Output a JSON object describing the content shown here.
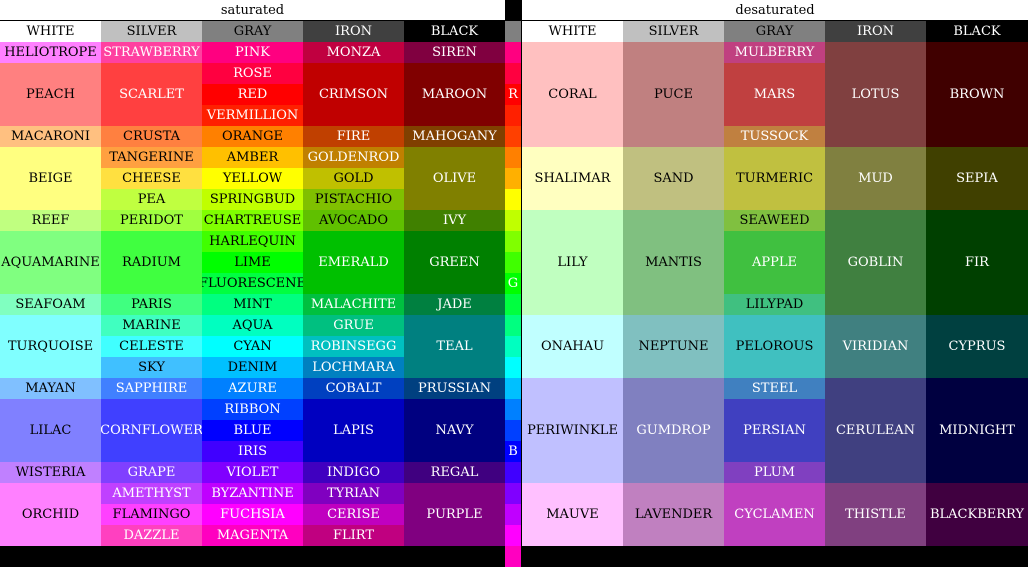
{
  "title_saturated": "saturated",
  "title_desaturated": "desaturated",
  "headers": {
    "saturated": [
      {
        "label": "WHITE",
        "bg": "#ffffff",
        "fg": "#000000"
      },
      {
        "label": "SILVER",
        "bg": "#c0c0c0",
        "fg": "#000000"
      },
      {
        "label": "GRAY",
        "bg": "#808080",
        "fg": "#000000"
      },
      {
        "label": "IRON",
        "bg": "#404040",
        "fg": "#ffffff"
      },
      {
        "label": "BLACK",
        "bg": "#000000",
        "fg": "#ffffff"
      }
    ],
    "desaturated": [
      {
        "label": "WHITE",
        "bg": "#ffffff",
        "fg": "#000000"
      },
      {
        "label": "SILVER",
        "bg": "#c0c0c0",
        "fg": "#000000"
      },
      {
        "label": "GRAY",
        "bg": "#808080",
        "fg": "#000000"
      },
      {
        "label": "IRON",
        "bg": "#404040",
        "fg": "#ffffff"
      },
      {
        "label": "BLACK",
        "bg": "#000000",
        "fg": "#ffffff"
      }
    ]
  },
  "strip": [
    {
      "label": "",
      "bg": "#ff0080"
    },
    {
      "label": "",
      "bg": "#ff0080"
    },
    {
      "label": "",
      "bg": "#ff0040"
    },
    {
      "label": "R",
      "bg": "#ff0000"
    },
    {
      "label": "",
      "bg": "#ff2000"
    },
    {
      "label": "",
      "bg": "#ff4000"
    },
    {
      "label": "",
      "bg": "#ff8000"
    },
    {
      "label": "",
      "bg": "#ffb000"
    },
    {
      "label": "",
      "bg": "#ffff00"
    },
    {
      "label": "",
      "bg": "#c0ff00"
    },
    {
      "label": "",
      "bg": "#80ff00"
    },
    {
      "label": "",
      "bg": "#40ff00"
    },
    {
      "label": "G",
      "bg": "#00ff00"
    },
    {
      "label": "",
      "bg": "#00ff40"
    },
    {
      "label": "",
      "bg": "#00ff80"
    },
    {
      "label": "",
      "bg": "#00ffc0"
    },
    {
      "label": "",
      "bg": "#00ffff"
    },
    {
      "label": "",
      "bg": "#00c0ff"
    },
    {
      "label": "",
      "bg": "#0080ff"
    },
    {
      "label": "",
      "bg": "#0040ff"
    },
    {
      "label": "B",
      "bg": "#0000ff"
    },
    {
      "label": "",
      "bg": "#4000ff"
    },
    {
      "label": "",
      "bg": "#8000ff"
    },
    {
      "label": "",
      "bg": "#c000ff"
    },
    {
      "label": "",
      "bg": "#ff00ff"
    },
    {
      "label": "",
      "bg": "#ff00c0"
    }
  ],
  "saturated": {
    "white": [
      {
        "label": "HELIOTROPE",
        "span": [
          0,
          1
        ],
        "bg": "#ff80ff"
      },
      {
        "label": "PEACH",
        "span": [
          1,
          4
        ],
        "bg": "#ff8080"
      },
      {
        "label": "MACARONI",
        "span": [
          4,
          5
        ],
        "bg": "#ffc080"
      },
      {
        "label": "BEIGE",
        "span": [
          5,
          8
        ],
        "bg": "#ffff80"
      },
      {
        "label": "REEF",
        "span": [
          8,
          9
        ],
        "bg": "#c0ff80"
      },
      {
        "label": "AQUAMARINE",
        "span": [
          9,
          12
        ],
        "bg": "#80ff80"
      },
      {
        "label": "SEAFOAM",
        "span": [
          12,
          13
        ],
        "bg": "#80ffc0"
      },
      {
        "label": "TURQUOISE",
        "span": [
          13,
          16
        ],
        "bg": "#80ffff"
      },
      {
        "label": "MAYAN",
        "span": [
          16,
          17
        ],
        "bg": "#80c0ff"
      },
      {
        "label": "LILAC",
        "span": [
          17,
          20
        ],
        "bg": "#8080ff"
      },
      {
        "label": "WISTERIA",
        "span": [
          20,
          21
        ],
        "bg": "#c080ff"
      },
      {
        "label": "ORCHID",
        "span": [
          21,
          24
        ],
        "bg": "#ff80ff"
      }
    ],
    "silver": [
      {
        "label": "STRAWBERRY",
        "span": [
          0,
          1
        ],
        "bg": "#ff40a0"
      },
      {
        "label": "SCARLET",
        "span": [
          1,
          4
        ],
        "bg": "#ff4040"
      },
      {
        "label": "CRUSTA",
        "span": [
          4,
          5
        ],
        "bg": "#ff8040"
      },
      {
        "label": "TANGERINE",
        "span": [
          5,
          6
        ],
        "bg": "#ffa040"
      },
      {
        "label": "CHEESE",
        "span": [
          6,
          7
        ],
        "bg": "#ffe040"
      },
      {
        "label": "PEA",
        "span": [
          7,
          8
        ],
        "bg": "#c0ff40"
      },
      {
        "label": "PERIDOT",
        "span": [
          8,
          9
        ],
        "bg": "#a0ff40"
      },
      {
        "label": "RADIUM",
        "span": [
          9,
          12
        ],
        "bg": "#40ff40"
      },
      {
        "label": "PARIS",
        "span": [
          12,
          13
        ],
        "bg": "#40ff80"
      },
      {
        "label": "MARINE",
        "span": [
          13,
          14
        ],
        "bg": "#40ffc0"
      },
      {
        "label": "CELESTE",
        "span": [
          14,
          15
        ],
        "bg": "#40ffff"
      },
      {
        "label": "SKY",
        "span": [
          15,
          16
        ],
        "bg": "#40c0ff"
      },
      {
        "label": "SAPPHIRE",
        "span": [
          16,
          17
        ],
        "bg": "#4080ff"
      },
      {
        "label": "CORNFLOWER",
        "span": [
          17,
          20
        ],
        "bg": "#4040ff"
      },
      {
        "label": "GRAPE",
        "span": [
          20,
          21
        ],
        "bg": "#8040ff"
      },
      {
        "label": "AMETHYST",
        "span": [
          21,
          22
        ],
        "bg": "#c040ff"
      },
      {
        "label": "FLAMINGO",
        "span": [
          22,
          23
        ],
        "bg": "#ff40ff"
      },
      {
        "label": "DAZZLE",
        "span": [
          23,
          24
        ],
        "bg": "#ff40c0"
      }
    ],
    "gray": [
      {
        "label": "PINK",
        "span": [
          0,
          1
        ],
        "bg": "#ff0080"
      },
      {
        "label": "ROSE",
        "span": [
          1,
          2
        ],
        "bg": "#ff0040"
      },
      {
        "label": "RED",
        "span": [
          2,
          3
        ],
        "bg": "#ff0000"
      },
      {
        "label": "VERMILLION",
        "span": [
          3,
          4
        ],
        "bg": "#ff2000"
      },
      {
        "label": "ORANGE",
        "span": [
          4,
          5
        ],
        "bg": "#ff8000"
      },
      {
        "label": "AMBER",
        "span": [
          5,
          6
        ],
        "bg": "#ffc000"
      },
      {
        "label": "YELLOW",
        "span": [
          6,
          7
        ],
        "bg": "#ffff00"
      },
      {
        "label": "SPRINGBUD",
        "span": [
          7,
          8
        ],
        "bg": "#c0ff00"
      },
      {
        "label": "CHARTREUSE",
        "span": [
          8,
          9
        ],
        "bg": "#80ff00"
      },
      {
        "label": "HARLEQUIN",
        "span": [
          9,
          10
        ],
        "bg": "#40ff00"
      },
      {
        "label": "LIME",
        "span": [
          10,
          11
        ],
        "bg": "#00ff00"
      },
      {
        "label": "FLUORESCENE",
        "span": [
          11,
          12
        ],
        "bg": "#00ff40"
      },
      {
        "label": "MINT",
        "span": [
          12,
          13
        ],
        "bg": "#00ff80"
      },
      {
        "label": "AQUA",
        "span": [
          13,
          14
        ],
        "bg": "#00ffc0"
      },
      {
        "label": "CYAN",
        "span": [
          14,
          15
        ],
        "bg": "#00ffff"
      },
      {
        "label": "DENIM",
        "span": [
          15,
          16
        ],
        "bg": "#00c0ff"
      },
      {
        "label": "AZURE",
        "span": [
          16,
          17
        ],
        "bg": "#0080ff"
      },
      {
        "label": "RIBBON",
        "span": [
          17,
          18
        ],
        "bg": "#0040ff"
      },
      {
        "label": "BLUE",
        "span": [
          18,
          19
        ],
        "bg": "#0000ff"
      },
      {
        "label": "IRIS",
        "span": [
          19,
          20
        ],
        "bg": "#4000ff"
      },
      {
        "label": "VIOLET",
        "span": [
          20,
          21
        ],
        "bg": "#8000ff"
      },
      {
        "label": "BYZANTINE",
        "span": [
          21,
          22
        ],
        "bg": "#c000ff"
      },
      {
        "label": "FUCHSIA",
        "span": [
          22,
          23
        ],
        "bg": "#ff00ff"
      },
      {
        "label": "MAGENTA",
        "span": [
          23,
          24
        ],
        "bg": "#ff00c0"
      }
    ],
    "iron": [
      {
        "label": "MONZA",
        "span": [
          0,
          1
        ],
        "bg": "#c00040"
      },
      {
        "label": "CRIMSON",
        "span": [
          1,
          4
        ],
        "bg": "#c00000"
      },
      {
        "label": "FIRE",
        "span": [
          4,
          5
        ],
        "bg": "#c04000"
      },
      {
        "label": "GOLDENROD",
        "span": [
          5,
          6
        ],
        "bg": "#c08000"
      },
      {
        "label": "GOLD",
        "span": [
          6,
          7
        ],
        "bg": "#c0c000"
      },
      {
        "label": "PISTACHIO",
        "span": [
          7,
          8
        ],
        "bg": "#80c000"
      },
      {
        "label": "AVOCADO",
        "span": [
          8,
          9
        ],
        "bg": "#60c000"
      },
      {
        "label": "EMERALD",
        "span": [
          9,
          12
        ],
        "bg": "#00c000"
      },
      {
        "label": "MALACHITE",
        "span": [
          12,
          13
        ],
        "bg": "#00c040"
      },
      {
        "label": "GRUE",
        "span": [
          13,
          14
        ],
        "bg": "#00c080"
      },
      {
        "label": "ROBINSEGG",
        "span": [
          14,
          15
        ],
        "bg": "#00c0c0"
      },
      {
        "label": "LOCHMARA",
        "span": [
          15,
          16
        ],
        "bg": "#0080c0"
      },
      {
        "label": "COBALT",
        "span": [
          16,
          17
        ],
        "bg": "#0040c0"
      },
      {
        "label": "LAPIS",
        "span": [
          17,
          20
        ],
        "bg": "#0000c0"
      },
      {
        "label": "INDIGO",
        "span": [
          20,
          21
        ],
        "bg": "#4000c0"
      },
      {
        "label": "TYRIAN",
        "span": [
          21,
          22
        ],
        "bg": "#8000c0"
      },
      {
        "label": "CERISE",
        "span": [
          22,
          23
        ],
        "bg": "#c000c0"
      },
      {
        "label": "FLIRT",
        "span": [
          23,
          24
        ],
        "bg": "#c00080"
      }
    ],
    "black": [
      {
        "label": "SIREN",
        "span": [
          0,
          1
        ],
        "bg": "#800040"
      },
      {
        "label": "MAROON",
        "span": [
          1,
          4
        ],
        "bg": "#800000"
      },
      {
        "label": "MAHOGANY",
        "span": [
          4,
          5
        ],
        "bg": "#804000"
      },
      {
        "label": "OLIVE",
        "span": [
          5,
          8
        ],
        "bg": "#808000"
      },
      {
        "label": "IVY",
        "span": [
          8,
          9
        ],
        "bg": "#408000"
      },
      {
        "label": "GREEN",
        "span": [
          9,
          12
        ],
        "bg": "#008000"
      },
      {
        "label": "JADE",
        "span": [
          12,
          13
        ],
        "bg": "#008040"
      },
      {
        "label": "TEAL",
        "span": [
          13,
          16
        ],
        "bg": "#008080"
      },
      {
        "label": "PRUSSIAN",
        "span": [
          16,
          17
        ],
        "bg": "#004080"
      },
      {
        "label": "NAVY",
        "span": [
          17,
          20
        ],
        "bg": "#000080"
      },
      {
        "label": "REGAL",
        "span": [
          20,
          21
        ],
        "bg": "#400080"
      },
      {
        "label": "PURPLE",
        "span": [
          21,
          24
        ],
        "bg": "#800080"
      }
    ]
  },
  "desaturated": {
    "white": [
      {
        "label": "CORAL",
        "span": [
          0,
          5
        ],
        "bg": "#ffc0c0"
      },
      {
        "label": "SHALIMAR",
        "span": [
          5,
          8
        ],
        "bg": "#ffffc0"
      },
      {
        "label": "LILY",
        "span": [
          8,
          13
        ],
        "bg": "#c0ffc0"
      },
      {
        "label": "ONAHAU",
        "span": [
          13,
          16
        ],
        "bg": "#c0ffff"
      },
      {
        "label": "PERIWINKLE",
        "span": [
          16,
          21
        ],
        "bg": "#c0c0ff"
      },
      {
        "label": "MAUVE",
        "span": [
          21,
          24
        ],
        "bg": "#ffc0ff"
      }
    ],
    "silver": [
      {
        "label": "PUCE",
        "span": [
          0,
          5
        ],
        "bg": "#c08080"
      },
      {
        "label": "SAND",
        "span": [
          5,
          8
        ],
        "bg": "#c0c080"
      },
      {
        "label": "MANTIS",
        "span": [
          8,
          13
        ],
        "bg": "#80c080"
      },
      {
        "label": "NEPTUNE",
        "span": [
          13,
          16
        ],
        "bg": "#80c0c0"
      },
      {
        "label": "GUMDROP",
        "span": [
          16,
          21
        ],
        "bg": "#8080c0"
      },
      {
        "label": "LAVENDER",
        "span": [
          21,
          24
        ],
        "bg": "#c080c0"
      }
    ],
    "gray": [
      {
        "label": "MULBERRY",
        "span": [
          0,
          1
        ],
        "bg": "#c04080"
      },
      {
        "label": "MARS",
        "span": [
          1,
          4
        ],
        "bg": "#c04040"
      },
      {
        "label": "TUSSOCK",
        "span": [
          4,
          5
        ],
        "bg": "#c08040"
      },
      {
        "label": "TURMERIC",
        "span": [
          5,
          8
        ],
        "bg": "#c0c040"
      },
      {
        "label": "SEAWEED",
        "span": [
          8,
          9
        ],
        "bg": "#80c040"
      },
      {
        "label": "APPLE",
        "span": [
          9,
          12
        ],
        "bg": "#40c040"
      },
      {
        "label": "LILYPAD",
        "span": [
          12,
          13
        ],
        "bg": "#40c080"
      },
      {
        "label": "PELOROUS",
        "span": [
          13,
          16
        ],
        "bg": "#40c0c0"
      },
      {
        "label": "STEEL",
        "span": [
          16,
          17
        ],
        "bg": "#4080c0"
      },
      {
        "label": "PERSIAN",
        "span": [
          17,
          20
        ],
        "bg": "#4040c0"
      },
      {
        "label": "PLUM",
        "span": [
          20,
          21
        ],
        "bg": "#8040c0"
      },
      {
        "label": "CYCLAMEN",
        "span": [
          21,
          24
        ],
        "bg": "#c040c0"
      }
    ],
    "iron": [
      {
        "label": "LOTUS",
        "span": [
          0,
          5
        ],
        "bg": "#804040"
      },
      {
        "label": "MUD",
        "span": [
          5,
          8
        ],
        "bg": "#808040"
      },
      {
        "label": "GOBLIN",
        "span": [
          8,
          13
        ],
        "bg": "#408040"
      },
      {
        "label": "VIRIDIAN",
        "span": [
          13,
          16
        ],
        "bg": "#408080"
      },
      {
        "label": "CERULEAN",
        "span": [
          16,
          21
        ],
        "bg": "#404080"
      },
      {
        "label": "THISTLE",
        "span": [
          21,
          24
        ],
        "bg": "#804080"
      }
    ],
    "black": [
      {
        "label": "BROWN",
        "span": [
          0,
          5
        ],
        "bg": "#400000"
      },
      {
        "label": "SEPIA",
        "span": [
          5,
          8
        ],
        "bg": "#404000"
      },
      {
        "label": "FIR",
        "span": [
          8,
          13
        ],
        "bg": "#004000"
      },
      {
        "label": "CYPRUS",
        "span": [
          13,
          16
        ],
        "bg": "#004040"
      },
      {
        "label": "MIDNIGHT",
        "span": [
          16,
          21
        ],
        "bg": "#000040"
      },
      {
        "label": "BLACKBERRY",
        "span": [
          21,
          24
        ],
        "bg": "#400040"
      }
    ]
  }
}
